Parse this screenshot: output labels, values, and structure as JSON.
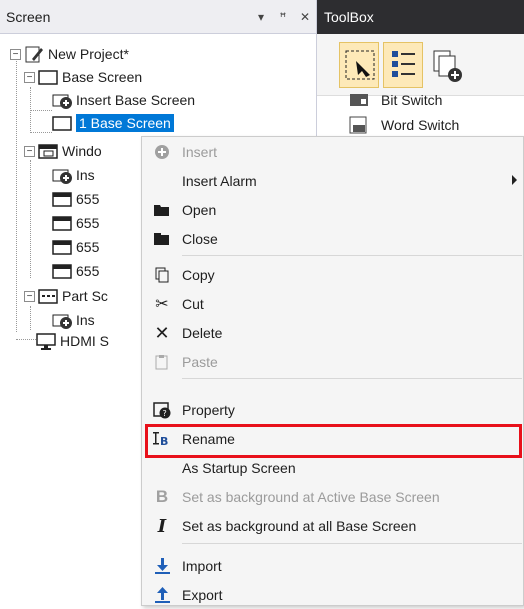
{
  "screen_panel": {
    "title": "Screen",
    "buttons": [
      "▾",
      "ꟸ",
      "✕"
    ]
  },
  "toolbox": {
    "title": "ToolBox",
    "items": [
      "Bit Switch",
      "Word Switch"
    ]
  },
  "tree": {
    "project": "New Project*",
    "base_screen": "Base Screen",
    "insert_base_screen": "Insert Base Screen",
    "base_screen_1": "1 Base Screen",
    "window_screen": "Windo",
    "insert_window": "Ins",
    "win1": "655",
    "win2": "655",
    "win3": "655",
    "win4": "655",
    "part_screen": "Part Sc",
    "insert_part": "Ins",
    "hdmi": "HDMI S"
  },
  "context_menu": {
    "insert": "Insert",
    "insert_alarm": "Insert Alarm",
    "open": "Open",
    "close": "Close",
    "copy": "Copy",
    "cut": "Cut",
    "delete": "Delete",
    "paste": "Paste",
    "property": "Property",
    "rename": "Rename",
    "as_startup": "As Startup Screen",
    "set_bg_active": "Set as background at Active Base Screen",
    "set_bg_all": "Set as background at all Base Screen",
    "import": "Import",
    "export": "Export"
  },
  "colors": {
    "highlight_box": "#e8101a",
    "selection": "#0078d7",
    "toolbox_header": "#2d2d30"
  }
}
